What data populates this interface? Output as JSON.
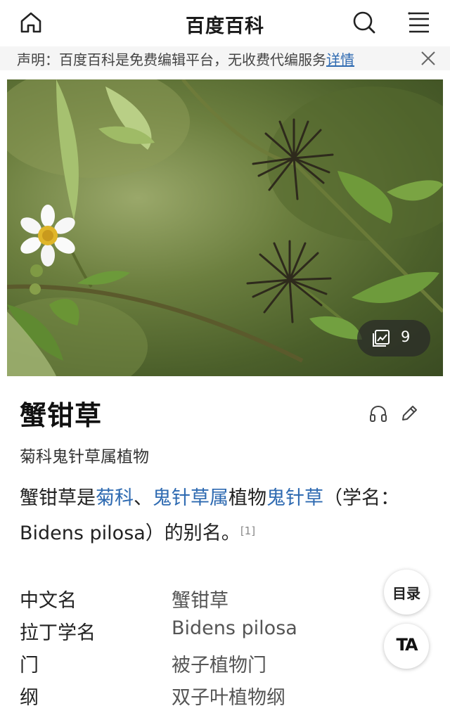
{
  "header": {
    "title": "百度百科"
  },
  "notice": {
    "text": "声明：百度百科是免费编辑平台，无收费代编服务",
    "link": "详情"
  },
  "hero": {
    "image_count": "9"
  },
  "entry": {
    "title": "蟹钳草",
    "subtitle": "菊科鬼针草属植物",
    "summary": {
      "p1": "蟹钳草是",
      "link1": "菊科",
      "sep": "、",
      "link2": "鬼针草属",
      "p2": "植物",
      "link3": "鬼针草",
      "p3": "（学名：Bidens pilosa）的别名。",
      "ref": "[1]"
    }
  },
  "info_rows": [
    {
      "key": "中文名",
      "value": "蟹钳草"
    },
    {
      "key": "拉丁学名",
      "value": "Bidens pilosa"
    },
    {
      "key": "门",
      "value": "被子植物门"
    },
    {
      "key": "纲",
      "value": "双子叶植物纲"
    }
  ],
  "fab": {
    "toc": "目录",
    "ta": "TA"
  },
  "icons": [
    "home-icon",
    "search-icon",
    "menu-icon",
    "close-icon",
    "gallery-icon",
    "headphones-icon",
    "pencil-icon"
  ]
}
